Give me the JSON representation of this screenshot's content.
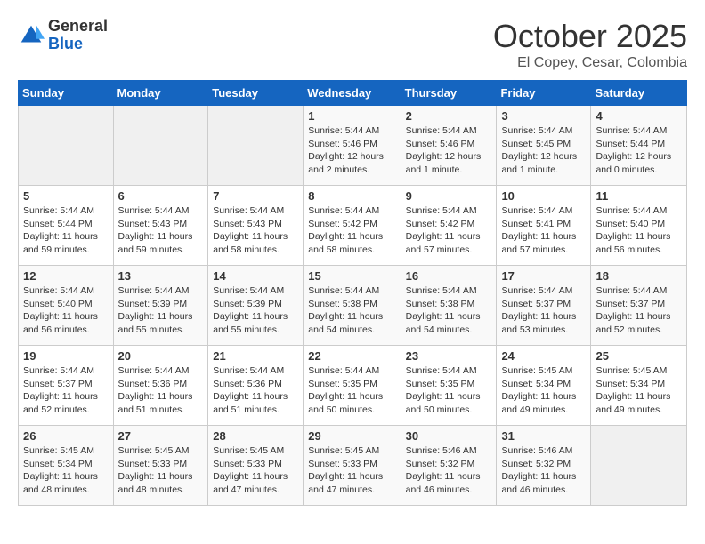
{
  "header": {
    "logo_general": "General",
    "logo_blue": "Blue",
    "month_title": "October 2025",
    "subtitle": "El Copey, Cesar, Colombia"
  },
  "weekdays": [
    "Sunday",
    "Monday",
    "Tuesday",
    "Wednesday",
    "Thursday",
    "Friday",
    "Saturday"
  ],
  "weeks": [
    [
      {
        "day": "",
        "sunrise": "",
        "sunset": "",
        "daylight": ""
      },
      {
        "day": "",
        "sunrise": "",
        "sunset": "",
        "daylight": ""
      },
      {
        "day": "",
        "sunrise": "",
        "sunset": "",
        "daylight": ""
      },
      {
        "day": "1",
        "sunrise": "Sunrise: 5:44 AM",
        "sunset": "Sunset: 5:46 PM",
        "daylight": "Daylight: 12 hours and 2 minutes."
      },
      {
        "day": "2",
        "sunrise": "Sunrise: 5:44 AM",
        "sunset": "Sunset: 5:46 PM",
        "daylight": "Daylight: 12 hours and 1 minute."
      },
      {
        "day": "3",
        "sunrise": "Sunrise: 5:44 AM",
        "sunset": "Sunset: 5:45 PM",
        "daylight": "Daylight: 12 hours and 1 minute."
      },
      {
        "day": "4",
        "sunrise": "Sunrise: 5:44 AM",
        "sunset": "Sunset: 5:44 PM",
        "daylight": "Daylight: 12 hours and 0 minutes."
      }
    ],
    [
      {
        "day": "5",
        "sunrise": "Sunrise: 5:44 AM",
        "sunset": "Sunset: 5:44 PM",
        "daylight": "Daylight: 11 hours and 59 minutes."
      },
      {
        "day": "6",
        "sunrise": "Sunrise: 5:44 AM",
        "sunset": "Sunset: 5:43 PM",
        "daylight": "Daylight: 11 hours and 59 minutes."
      },
      {
        "day": "7",
        "sunrise": "Sunrise: 5:44 AM",
        "sunset": "Sunset: 5:43 PM",
        "daylight": "Daylight: 11 hours and 58 minutes."
      },
      {
        "day": "8",
        "sunrise": "Sunrise: 5:44 AM",
        "sunset": "Sunset: 5:42 PM",
        "daylight": "Daylight: 11 hours and 58 minutes."
      },
      {
        "day": "9",
        "sunrise": "Sunrise: 5:44 AM",
        "sunset": "Sunset: 5:42 PM",
        "daylight": "Daylight: 11 hours and 57 minutes."
      },
      {
        "day": "10",
        "sunrise": "Sunrise: 5:44 AM",
        "sunset": "Sunset: 5:41 PM",
        "daylight": "Daylight: 11 hours and 57 minutes."
      },
      {
        "day": "11",
        "sunrise": "Sunrise: 5:44 AM",
        "sunset": "Sunset: 5:40 PM",
        "daylight": "Daylight: 11 hours and 56 minutes."
      }
    ],
    [
      {
        "day": "12",
        "sunrise": "Sunrise: 5:44 AM",
        "sunset": "Sunset: 5:40 PM",
        "daylight": "Daylight: 11 hours and 56 minutes."
      },
      {
        "day": "13",
        "sunrise": "Sunrise: 5:44 AM",
        "sunset": "Sunset: 5:39 PM",
        "daylight": "Daylight: 11 hours and 55 minutes."
      },
      {
        "day": "14",
        "sunrise": "Sunrise: 5:44 AM",
        "sunset": "Sunset: 5:39 PM",
        "daylight": "Daylight: 11 hours and 55 minutes."
      },
      {
        "day": "15",
        "sunrise": "Sunrise: 5:44 AM",
        "sunset": "Sunset: 5:38 PM",
        "daylight": "Daylight: 11 hours and 54 minutes."
      },
      {
        "day": "16",
        "sunrise": "Sunrise: 5:44 AM",
        "sunset": "Sunset: 5:38 PM",
        "daylight": "Daylight: 11 hours and 54 minutes."
      },
      {
        "day": "17",
        "sunrise": "Sunrise: 5:44 AM",
        "sunset": "Sunset: 5:37 PM",
        "daylight": "Daylight: 11 hours and 53 minutes."
      },
      {
        "day": "18",
        "sunrise": "Sunrise: 5:44 AM",
        "sunset": "Sunset: 5:37 PM",
        "daylight": "Daylight: 11 hours and 52 minutes."
      }
    ],
    [
      {
        "day": "19",
        "sunrise": "Sunrise: 5:44 AM",
        "sunset": "Sunset: 5:37 PM",
        "daylight": "Daylight: 11 hours and 52 minutes."
      },
      {
        "day": "20",
        "sunrise": "Sunrise: 5:44 AM",
        "sunset": "Sunset: 5:36 PM",
        "daylight": "Daylight: 11 hours and 51 minutes."
      },
      {
        "day": "21",
        "sunrise": "Sunrise: 5:44 AM",
        "sunset": "Sunset: 5:36 PM",
        "daylight": "Daylight: 11 hours and 51 minutes."
      },
      {
        "day": "22",
        "sunrise": "Sunrise: 5:44 AM",
        "sunset": "Sunset: 5:35 PM",
        "daylight": "Daylight: 11 hours and 50 minutes."
      },
      {
        "day": "23",
        "sunrise": "Sunrise: 5:44 AM",
        "sunset": "Sunset: 5:35 PM",
        "daylight": "Daylight: 11 hours and 50 minutes."
      },
      {
        "day": "24",
        "sunrise": "Sunrise: 5:45 AM",
        "sunset": "Sunset: 5:34 PM",
        "daylight": "Daylight: 11 hours and 49 minutes."
      },
      {
        "day": "25",
        "sunrise": "Sunrise: 5:45 AM",
        "sunset": "Sunset: 5:34 PM",
        "daylight": "Daylight: 11 hours and 49 minutes."
      }
    ],
    [
      {
        "day": "26",
        "sunrise": "Sunrise: 5:45 AM",
        "sunset": "Sunset: 5:34 PM",
        "daylight": "Daylight: 11 hours and 48 minutes."
      },
      {
        "day": "27",
        "sunrise": "Sunrise: 5:45 AM",
        "sunset": "Sunset: 5:33 PM",
        "daylight": "Daylight: 11 hours and 48 minutes."
      },
      {
        "day": "28",
        "sunrise": "Sunrise: 5:45 AM",
        "sunset": "Sunset: 5:33 PM",
        "daylight": "Daylight: 11 hours and 47 minutes."
      },
      {
        "day": "29",
        "sunrise": "Sunrise: 5:45 AM",
        "sunset": "Sunset: 5:33 PM",
        "daylight": "Daylight: 11 hours and 47 minutes."
      },
      {
        "day": "30",
        "sunrise": "Sunrise: 5:46 AM",
        "sunset": "Sunset: 5:32 PM",
        "daylight": "Daylight: 11 hours and 46 minutes."
      },
      {
        "day": "31",
        "sunrise": "Sunrise: 5:46 AM",
        "sunset": "Sunset: 5:32 PM",
        "daylight": "Daylight: 11 hours and 46 minutes."
      },
      {
        "day": "",
        "sunrise": "",
        "sunset": "",
        "daylight": ""
      }
    ]
  ]
}
